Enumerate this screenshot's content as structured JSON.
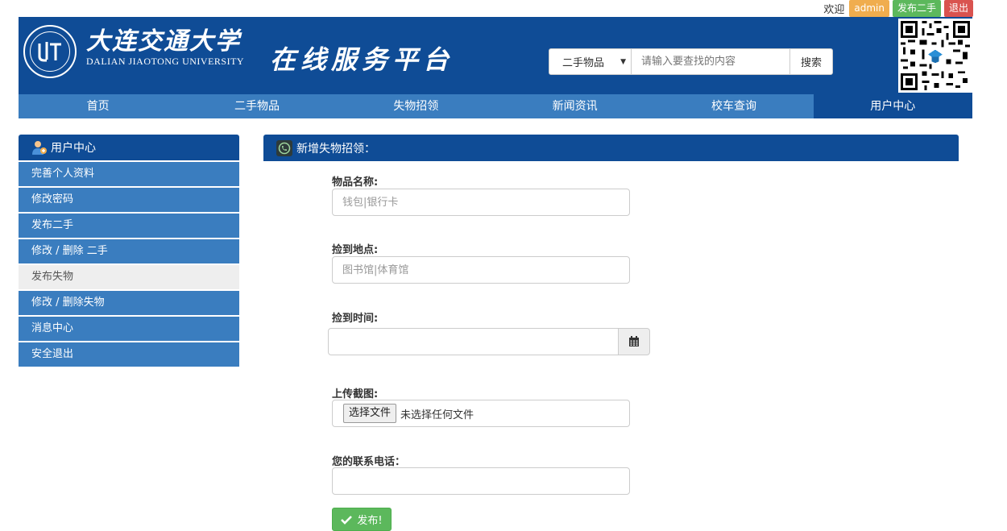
{
  "topbar": {
    "welcome": "欢迎",
    "username": "admin",
    "post_label": "发布二手",
    "logout_label": "退出"
  },
  "header": {
    "university_cn": "大连交通大学",
    "university_en": "DALIAN JIAOTONG UNIVERSITY",
    "platform_title": "在线服务平台",
    "search": {
      "category": "二手物品",
      "placeholder": "请输入要查找的内容",
      "button_label": "搜索"
    }
  },
  "nav": {
    "items": [
      {
        "label": "首页"
      },
      {
        "label": "二手物品"
      },
      {
        "label": "失物招领"
      },
      {
        "label": "新闻资讯"
      },
      {
        "label": "校车查询"
      },
      {
        "label": "用户中心"
      }
    ],
    "active_index": 5
  },
  "sidebar": {
    "title": "用户中心",
    "items": [
      {
        "label": "完善个人资料"
      },
      {
        "label": "修改密码"
      },
      {
        "label": "发布二手"
      },
      {
        "label": "修改 / 删除 二手"
      },
      {
        "label": "发布失物"
      },
      {
        "label": "修改 / 删除失物"
      },
      {
        "label": "消息中心"
      },
      {
        "label": "安全退出"
      }
    ],
    "current_index": 4
  },
  "form": {
    "title": "新增失物招领：",
    "item_name_label": "物品名称:",
    "item_name_placeholder": "钱包|银行卡",
    "place_label": "捡到地点:",
    "place_placeholder": "图书馆|体育馆",
    "time_label": "捡到时间:",
    "upload_label": "上传截图:",
    "file_button": "选择文件",
    "file_status": "未选择任何文件",
    "phone_label": "您的联系电话：",
    "submit_label": "发布!"
  },
  "colors": {
    "header_blue": "#0f4c96",
    "nav_blue": "#3a7dbf",
    "success_green": "#5cb85c",
    "warning_orange": "#f0ad4e",
    "danger_red": "#d9534f"
  }
}
